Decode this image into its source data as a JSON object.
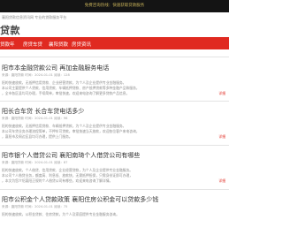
{
  "top_bar": {
    "text": "免费咨询热线：快速获取贷款服务"
  },
  "header": {
    "tagline": "襄阳贷款信息资讯网 专业的贷款服务平台",
    "logo": "贷款"
  },
  "nav": {
    "items": [
      {
        "label": "贷款年"
      },
      {
        "label": "房贷车贷"
      },
      {
        "label": "襄阳贷款"
      },
      {
        "label": "房贷资讯"
      }
    ]
  },
  "articles": [
    {
      "title": "阳市本金融贷款公司 再加金融服务电话",
      "meta": "来源：襄阳贷款   时间：2024-01-01   阅读：128",
      "lines": [
        "阳的快速放款，无抵押信用贷款、企业经营贷款，为个人及企业提供专业金融服务。",
        "本公司主要提供个人贷款、信用贷款、车辆抵押贷款、房产抵押贷款等多种金融产品和服务，",
        "，全市各区县均可办理，手续简单，审批快速，欢迎来电咨询了解更多贷款产品信息。"
      ],
      "more": "详细"
    },
    {
      "title": "阳长合车贷 长合车贷电话多少",
      "meta": "来源：襄阳贷款   时间：2024-01-01   阅读：96",
      "lines": [
        "阳的快速放款，无抵押信用贷款、车辆抵押贷款，为个人及企业提供专业金融服务。",
        "本公司车贷业务办理流程简单，不押车可贷款，审批快速当天放款，欢迎各位客户来电咨询，",
        "，襄阳市及周边区县均可办理，提供上门服务。"
      ],
      "more": "详细"
    },
    {
      "title": "阳市银个人借贷公司 襄阳南琦个人借贷公司有哪些",
      "meta": "来源：襄阳贷款   时间：2024-01-01   阅读：87",
      "lines": [
        "阳的快速放款，个人借贷、信用贷款、企业经营贷款，为个人及企业提供专业金融服务。",
        "本公司个人借贷业务，额度高、利息低、放款快，无需抵押担保，只需身份证即可办理，",
        "，本文为您介绍襄阳正规的个人借贷公司有哪些，欢迎来电咨询了解详情。"
      ],
      "more": "详细"
    },
    {
      "title": "阳市公积金个人贷款政策 襄阳住房公积金可以贷款多少钱",
      "meta": "来源：襄阳贷款   时间：2024-01-01   阅读：75",
      "lines": [
        "阳的快速放款，公积金贷款、住房贷款，为个人及家庭提供专业金融服务咨询。"
      ],
      "more": ""
    }
  ]
}
